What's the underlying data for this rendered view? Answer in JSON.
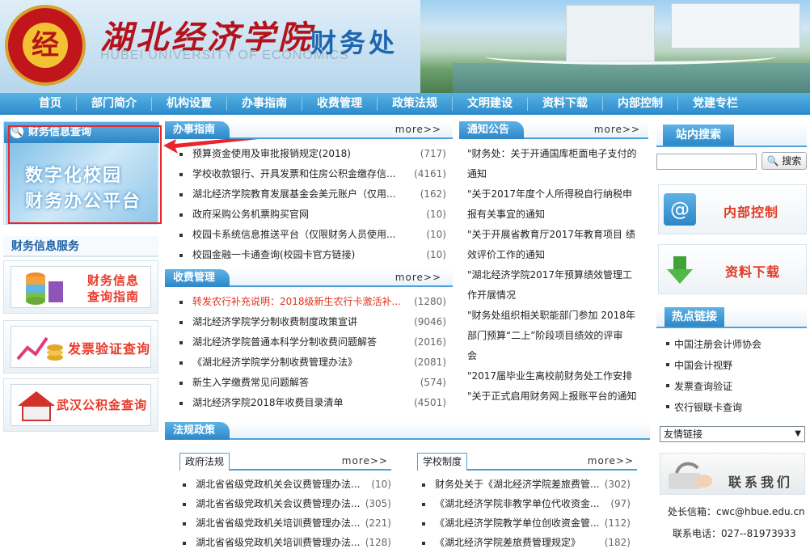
{
  "header": {
    "logo_char": "经",
    "uni_name": "湖北经济学院",
    "uni_en": "HUBEI UNIVERSITY OF ECONOMICS",
    "dept": "财务处"
  },
  "nav": [
    "首页",
    "部门简介",
    "机构设置",
    "办事指南",
    "收费管理",
    "政策法规",
    "文明建设",
    "资料下载",
    "内部控制",
    "党建专栏"
  ],
  "left": {
    "query_title": "财务信息查询",
    "query_img_line1": "数字化校园",
    "query_img_line2": "财务办公平台",
    "service_title": "财务信息服务",
    "services": [
      {
        "label_line1": "财务信息",
        "label_line2": "查询指南"
      },
      {
        "label_line1": "发票验证查询",
        "label_line2": ""
      },
      {
        "label_line1": "武汉公积金查询",
        "label_line2": ""
      }
    ]
  },
  "guide": {
    "title": "办事指南",
    "more": "more>>",
    "items": [
      {
        "text": "预算资金使用及审批报销规定(2018)",
        "count": "(717)"
      },
      {
        "text": "学校收款银行、开具发票和住房公积金缴存信...",
        "count": "(4161)"
      },
      {
        "text": "湖北经济学院教育发展基金会美元账户（仅用...",
        "count": "(162)"
      },
      {
        "text": "政府采购公务机票购买官网",
        "count": "(10)"
      },
      {
        "text": "校园卡系统信息推送平台（仅限财务人员使用...",
        "count": "(10)"
      },
      {
        "text": "校园金融一卡通查询(校园卡官方链接)",
        "count": "(10)"
      }
    ]
  },
  "fees": {
    "title": "收费管理",
    "more": "more>>",
    "items": [
      {
        "text": "转发农行补充说明：2018级新生农行卡激活补...",
        "count": "(1280)",
        "red": true
      },
      {
        "text": "湖北经济学院学分制收费制度政策宣讲",
        "count": "(9046)",
        "red": false
      },
      {
        "text": "湖北经济学院普通本科学分制收费问题解答",
        "count": "(2016)",
        "red": false
      },
      {
        "text": "《湖北经济学院学分制收费管理办法》",
        "count": "(2081)",
        "red": false
      },
      {
        "text": "新生入学缴费常见问题解答",
        "count": "(574)",
        "red": false
      },
      {
        "text": "湖北经济学院2018年收费目录清单",
        "count": "(4501)",
        "red": false
      }
    ]
  },
  "notice": {
    "title": "通知公告",
    "more": "more>>",
    "items": [
      {
        "l1": "\"财务处：关于开通国库柜面电子支付的",
        "l2": "通知"
      },
      {
        "l1": "\"关于2017年度个人所得税自行纳税申",
        "l2": "报有关事宜的通知"
      },
      {
        "l1": "\"关于开展省教育厅2017年教育项目 绩",
        "l2": "效评价工作的通知"
      },
      {
        "l1": "\"湖北经济学院2017年预算绩效管理工",
        "l2": "作开展情况"
      },
      {
        "l1": "\"财务处组织相关职能部门参加 2018年",
        "l2": "部门预算“二上”阶段项目绩效的评审"
      },
      {
        "l1": "会",
        "l2": ""
      },
      {
        "l1": "\"2017届毕业生离校前财务处工作安排",
        "l2": ""
      },
      {
        "l1": "\"关于正式启用财务网上报账平台的通知",
        "l2": ""
      }
    ]
  },
  "law": {
    "title": "法规政策",
    "gov": {
      "title": "政府法规",
      "more": "more>>",
      "items": [
        {
          "text": "湖北省省级党政机关会议费管理办法...",
          "count": "(10)"
        },
        {
          "text": "湖北省省级党政机关会议费管理办法...",
          "count": "(305)"
        },
        {
          "text": "湖北省省级党政机关培训费管理办法...",
          "count": "(221)"
        },
        {
          "text": "湖北省省级党政机关培训费管理办法...",
          "count": "(128)"
        }
      ]
    },
    "school": {
      "title": "学校制度",
      "more": "more>>",
      "items": [
        {
          "text": "财务处关于《湖北经济学院差旅费管...",
          "count": "(302)"
        },
        {
          "text": "《湖北经济学院非教学单位代收资金...",
          "count": "(97)"
        },
        {
          "text": "《湖北经济学院教学单位创收资金管...",
          "count": "(112)"
        },
        {
          "text": "《湖北经济学院差旅费管理规定》",
          "count": "(182)"
        }
      ]
    }
  },
  "right": {
    "search_title": "站内搜索",
    "search_placeholder": "",
    "search_button": "搜索",
    "internal_control": "内部控制",
    "downloads": "资料下载",
    "hot_title": "热点链接",
    "hot_links": [
      "中国注册会计师协会",
      "中国会计视野",
      "发票查询验证",
      "农行银联卡查询"
    ],
    "friend_links": "友情链接",
    "contact_label": "联系我们",
    "mailbox": "处长信箱：cwc@hbue.edu.cn",
    "phone": "联系电话：027--81973933"
  }
}
